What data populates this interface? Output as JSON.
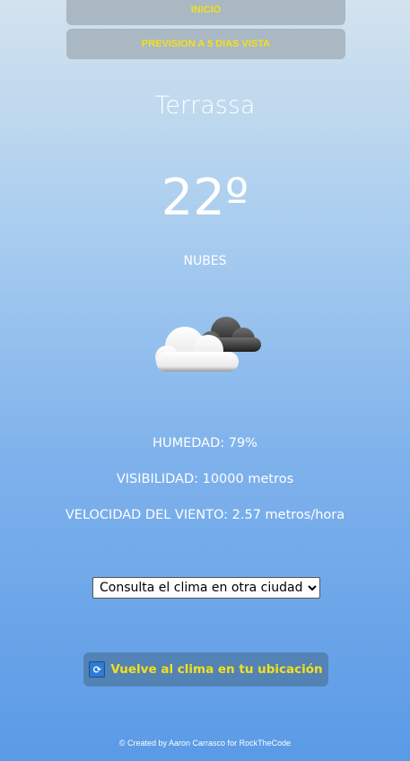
{
  "nav": {
    "inicio": "INICIO",
    "prevision": "PREVISION A 5 DIAS VISTA"
  },
  "weather": {
    "city": "Terrassa",
    "temperature": "22º",
    "description": "NUBES",
    "icon": "cloud-icon",
    "humidity": "HUMEDAD: 79%",
    "visibility": "VISIBILIDAD: 10000 metros",
    "wind": "VELOCIDAD DEL VIENTO: 2.57 metros/hora"
  },
  "city_select": {
    "selected": "Consulta el clima en otra ciudad:"
  },
  "location_button": {
    "icon": "refresh-icon",
    "label": "Vuelve al clima en tu ubicación"
  },
  "footer": "© Created by Aaron Carrasco for RockTheCode",
  "colors": {
    "accent_text": "#f3e01d",
    "nav_button_bg": "#aab8c3",
    "location_button_bg": "#5383b4"
  }
}
